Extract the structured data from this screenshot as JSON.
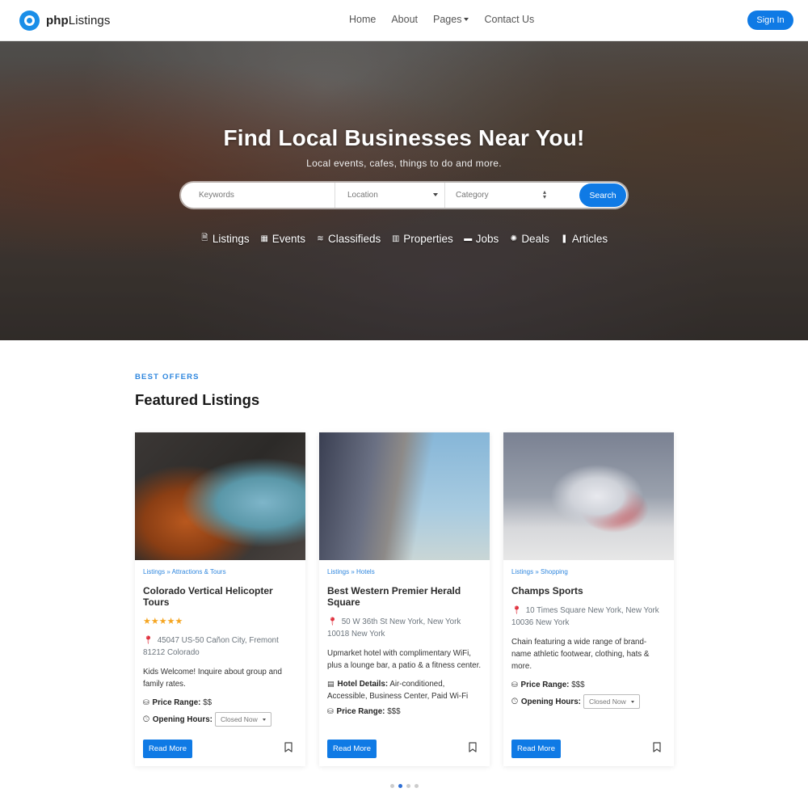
{
  "navbar": {
    "brand_bold": "php",
    "brand_rest": "Listings",
    "links": [
      {
        "label": "Home"
      },
      {
        "label": "About"
      },
      {
        "label": "Pages",
        "has_dropdown": true
      },
      {
        "label": "Contact Us"
      }
    ],
    "signin_label": "Sign In"
  },
  "hero": {
    "title": "Find Local Businesses Near You!",
    "subtitle": "Local events, cafes, things to do and more.",
    "search": {
      "keywords_placeholder": "Keywords",
      "location_value": "Location",
      "category_value": "Category",
      "button_label": "Search"
    },
    "categories": [
      {
        "label": "Listings",
        "icon": "document-icon",
        "glyph": "🗎"
      },
      {
        "label": "Events",
        "icon": "calendar-icon",
        "glyph": "▦"
      },
      {
        "label": "Classifieds",
        "icon": "layers-icon",
        "glyph": "≋"
      },
      {
        "label": "Properties",
        "icon": "building-icon",
        "glyph": "▥"
      },
      {
        "label": "Jobs",
        "icon": "briefcase-icon",
        "glyph": "▬"
      },
      {
        "label": "Deals",
        "icon": "handshake-icon",
        "glyph": "✺"
      },
      {
        "label": "Articles",
        "icon": "reader-icon",
        "glyph": "❚"
      }
    ]
  },
  "section": {
    "eyebrow": "BEST OFFERS",
    "title": "Featured Listings"
  },
  "colors": {
    "accent": "#0f7ae5",
    "eyebrow": "#2e86de",
    "star": "#f5a623",
    "pin": "#e0323f"
  },
  "listings": [
    {
      "crumb": "Listings » Attractions & Tours",
      "title": "Colorado Vertical Helicopter Tours",
      "rating": 5,
      "stars": "★★★★★",
      "address": "45047 US-50 Cañon City, Fremont 81212 Colorado",
      "description": "Kids Welcome! Inquire about group and family rates.",
      "price_label": "Price Range:",
      "price": "$$",
      "hours_label": "Opening Hours:",
      "hours_value": "Closed Now",
      "read_more": "Read More"
    },
    {
      "crumb": "Listings » Hotels",
      "title": "Best Western Premier Herald Square",
      "address": "50 W 36th St New York, New York 10018 New York",
      "description": "Upmarket hotel with complimentary WiFi, plus a lounge bar, a patio & a fitness center.",
      "details_label": "Hotel Details:",
      "details": "Air-conditioned, Accessible, Business Center, Paid Wi-Fi",
      "price_label": "Price Range:",
      "price": "$$$",
      "read_more": "Read More"
    },
    {
      "crumb": "Listings » Shopping",
      "title": "Champs Sports",
      "address": "10 Times Square New York, New York 10036 New York",
      "description": "Chain featuring a wide range of brand-name athletic footwear, clothing, hats & more.",
      "price_label": "Price Range:",
      "price": "$$$",
      "hours_label": "Opening Hours:",
      "hours_value": "Closed Now",
      "read_more": "Read More"
    }
  ],
  "carousel": {
    "total_pages": 4,
    "active_page": 2
  }
}
